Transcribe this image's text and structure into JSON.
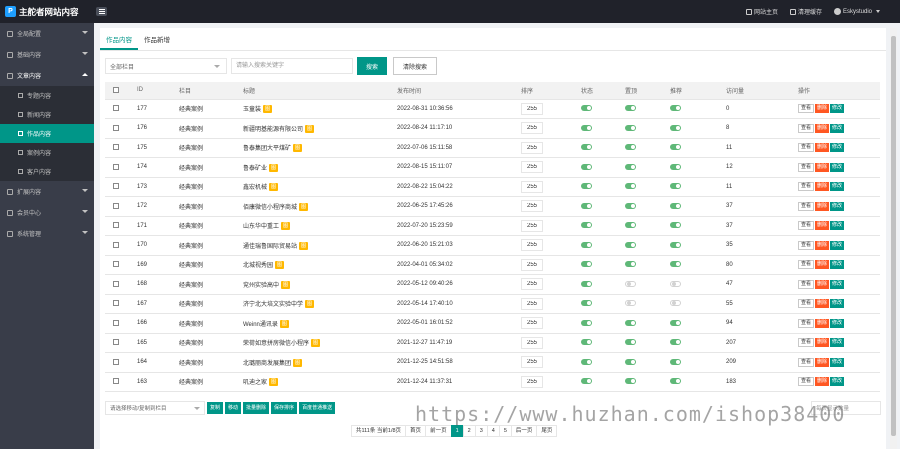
{
  "header": {
    "site_title": "主舵者网站内容",
    "logo_char": "P",
    "links": [
      {
        "label": "网站主页",
        "icon": "home-icon"
      },
      {
        "label": "清理缓存",
        "icon": "trash-icon"
      },
      {
        "label": "Eskystudio",
        "icon": "avatar"
      }
    ]
  },
  "sidebar": {
    "items": [
      {
        "label": "全局配置",
        "icon": "gear-icon"
      },
      {
        "label": "基础内容",
        "icon": "layers-icon"
      },
      {
        "label": "文章内容",
        "icon": "file-icon",
        "open": true,
        "children": [
          {
            "label": "专题内容"
          },
          {
            "label": "新闻内容"
          },
          {
            "label": "作品内容",
            "active": true
          },
          {
            "label": "案例内容"
          },
          {
            "label": "客户内容"
          }
        ]
      },
      {
        "label": "扩展内容",
        "icon": "puzzle-icon"
      },
      {
        "label": "会员中心",
        "icon": "user-icon"
      },
      {
        "label": "系统管理",
        "icon": "settings-icon"
      }
    ]
  },
  "tabs": [
    {
      "label": "作品内容",
      "active": true
    },
    {
      "label": "作品新增"
    }
  ],
  "filters": {
    "category_select": "全部栏目",
    "search_placeholder": "请输入搜索关键字",
    "search_button": "搜索",
    "clear_button": "清除搜索"
  },
  "table": {
    "headers": [
      "",
      "ID",
      "栏目",
      "标题",
      "发布时间",
      "排序",
      "状态",
      "置顶",
      "推荐",
      "访问量",
      "操作"
    ],
    "ops": {
      "view": "查看",
      "delete": "删除",
      "edit": "修改"
    },
    "badge": "图",
    "rows": [
      {
        "id": "177",
        "cat": "经典案例",
        "title": "玉童装",
        "time": "2022-08-31 10:36:56",
        "sort": "255",
        "status": true,
        "top": true,
        "rec": true,
        "views": "0"
      },
      {
        "id": "176",
        "cat": "经典案例",
        "title": "新疆明基能源有限公司",
        "time": "2022-08-24 11:17:10",
        "sort": "255",
        "status": true,
        "top": true,
        "rec": true,
        "views": "8"
      },
      {
        "id": "175",
        "cat": "经典案例",
        "title": "鲁泰集团大平煤矿",
        "time": "2022-07-06 15:11:58",
        "sort": "255",
        "status": true,
        "top": true,
        "rec": true,
        "views": "11"
      },
      {
        "id": "174",
        "cat": "经典案例",
        "title": "鲁泰矿业",
        "time": "2022-08-15 15:11:07",
        "sort": "255",
        "status": true,
        "top": true,
        "rec": true,
        "views": "12"
      },
      {
        "id": "173",
        "cat": "经典案例",
        "title": "鑫宏机械",
        "time": "2022-08-22 15:04:22",
        "sort": "255",
        "status": true,
        "top": true,
        "rec": true,
        "views": "11"
      },
      {
        "id": "172",
        "cat": "经典案例",
        "title": "佰康微信小程序商城",
        "time": "2022-06-25 17:45:26",
        "sort": "255",
        "status": true,
        "top": true,
        "rec": true,
        "views": "37"
      },
      {
        "id": "171",
        "cat": "经典案例",
        "title": "山东华中重工",
        "time": "2022-07-20 15:23:59",
        "sort": "255",
        "status": true,
        "top": true,
        "rec": true,
        "views": "37"
      },
      {
        "id": "170",
        "cat": "经典案例",
        "title": "通佳瑞鲁国际贸易站",
        "time": "2022-06-20 15:21:03",
        "sort": "255",
        "status": true,
        "top": true,
        "rec": true,
        "views": "35"
      },
      {
        "id": "169",
        "cat": "经典案例",
        "title": "北城视秀园",
        "time": "2022-04-01 05:34:02",
        "sort": "255",
        "status": true,
        "top": true,
        "rec": true,
        "views": "80"
      },
      {
        "id": "168",
        "cat": "经典案例",
        "title": "兖州实验高中",
        "time": "2022-05-12 09:40:26",
        "sort": "255",
        "status": true,
        "top": false,
        "rec": false,
        "views": "47"
      },
      {
        "id": "167",
        "cat": "经典案例",
        "title": "济宁北大培文实验中学",
        "time": "2022-05-14 17:40:10",
        "sort": "255",
        "status": true,
        "top": false,
        "rec": false,
        "views": "55"
      },
      {
        "id": "166",
        "cat": "经典案例",
        "title": "Weinn通讯录",
        "time": "2022-05-01 16:01:52",
        "sort": "255",
        "status": true,
        "top": true,
        "rec": true,
        "views": "94"
      },
      {
        "id": "165",
        "cat": "经典案例",
        "title": "荣荷如意拼房微信小程序",
        "time": "2021-12-27 11:47:19",
        "sort": "255",
        "status": true,
        "top": true,
        "rec": true,
        "views": "207"
      },
      {
        "id": "164",
        "cat": "经典案例",
        "title": "北璐丽商发展集团",
        "time": "2021-12-25 14:51:58",
        "sort": "255",
        "status": true,
        "top": true,
        "rec": true,
        "views": "209"
      },
      {
        "id": "163",
        "cat": "经典案例",
        "title": "叽迪之家",
        "time": "2021-12-24 11:37:31",
        "sort": "255",
        "status": true,
        "top": true,
        "rec": true,
        "views": "183"
      }
    ]
  },
  "bottom": {
    "move_select": "请选择移动/复制到栏目",
    "actions": [
      "复制",
      "移动",
      "批量删除",
      "保存排序",
      "百度普通推送"
    ],
    "per_page": "每页显示数量"
  },
  "pager": {
    "info": "共111条 当前1/8页",
    "first": "首页",
    "prev": "前一页",
    "pages": [
      "1",
      "2",
      "3",
      "4",
      "5"
    ],
    "current": "1",
    "next": "后一页",
    "last": "尾页"
  },
  "watermark": "https://www.huzhan.com/ishop38400",
  "colors": {
    "accent": "#009688",
    "header": "#20222a",
    "sidebar": "#393d49",
    "danger": "#ff5722",
    "badge": "#ffb800",
    "switch_on": "#5fb878"
  }
}
